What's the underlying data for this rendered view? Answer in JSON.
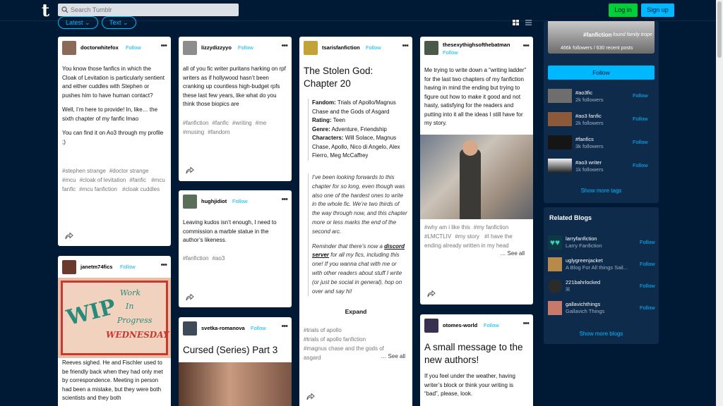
{
  "topbar": {
    "logo": "t",
    "search_placeholder": "Search Tumblr",
    "login": "Log in",
    "signup": "Sign up"
  },
  "filters": {
    "latest": "Latest ⌄",
    "text": "Text ⌄"
  },
  "posts": {
    "p1": {
      "user": "doctorwhitefox",
      "follow": "Follow",
      "paras": [
        "You know those fanfics in which the Cloak of Levitation is particularly sentient and either cuddles with Stephen or pushes him to have human contact?",
        "Well, I’m here to provide! In, like… the sixth chapter of my fanfic lmao",
        "You can find it on Ao3 through my profile ;)"
      ],
      "tags": [
        "#stephen strange",
        "#doctor strange",
        "#mcu",
        "#cloak of levitation",
        "#fanfic",
        "#mcu fanfic",
        "#mcu fanfiction",
        "#cloak cuddles"
      ]
    },
    "p2": {
      "user": "janetm74fics",
      "follow": "Follow",
      "img_lines": [
        "WIP",
        "Work",
        "In",
        "Progress",
        "WEDNESDAY"
      ],
      "text": "Reeves sighed. He and Fischler used to be friendly back when they had only met by correspondence. Meeting in person had been a mistake, but they were both scientists and they both"
    },
    "p3": {
      "user": "lizzydizzyyo",
      "follow": "Follow",
      "text": "all of you fic writer puritans harking on rpf writers as if hollywood hasn’t been cranking up countless high-budget rpfs these last few years, like what do you think those biopics are",
      "tags": [
        "#fanfiction",
        "#fanfic",
        "#writing",
        "#me",
        "#musing",
        "#fandom"
      ]
    },
    "p4": {
      "user": "hughjidiot",
      "follow": "Follow",
      "text": "Leaving kudos isn’t enough, I need to commission a marble statue in the author’s likeness.",
      "tags": [
        "#fanfiction",
        "#ao3"
      ]
    },
    "p5": {
      "user": "svetka-romanova",
      "follow": "Follow",
      "title": "Cursed (Series) Part 3"
    },
    "p6": {
      "user": "tsarisfanfiction",
      "follow": "Follow",
      "title": "The Stolen God: Chapter 20",
      "fandom_label": "Fandom:",
      "fandom": "Trials of Apollo/Magnus Chase and the Gods of Asgard",
      "rating_label": "Rating:",
      "rating": "Teen",
      "genre_label": "Genre:",
      "genre": "Adventure, Friendship",
      "chars_label": "Characters:",
      "chars": "Will Solace, Magnus Chase, Apollo, Nico di Angelo, Alex Fierro, Meg McCaffrey",
      "ital1": "I’ve been looking forwards to this chapter for so long, even though was also one of the hardest ones to write in the whole fic.  We’re two thirds of the way through now, and this chapter more or less marks the end of the second arc.",
      "ital2a": "Reminder that there’s now a ",
      "ital2link": "discord server",
      "ital2b": " for all my fics, including this one!  If you wanna chat with me or with other readers about stuff I write (or just be social in general), hop on over and say hi!",
      "expand": "Expand",
      "tags": [
        "#trials of apollo",
        "#trials of apollo fanfiction",
        "#magnus chase and the gods of asgard"
      ],
      "see_all": "… See all"
    },
    "p7": {
      "user": "thesexythighsofthebatman",
      "follow": "Follow",
      "text": "Me trying to write down a “writing ladder” for the last two chapters of my fanfiction having in mind the ending but trying to figure out how to make it good and not hasty, satisfying for the readers and putting into it all the ideas I still have for my story.",
      "tags": [
        "#why am i like this",
        "#my fanfiction",
        "#LMCTLIV",
        "#my story",
        "#I have the ending already written in my head"
      ],
      "see_all": "… See all"
    },
    "p8": {
      "user": "otomes-world",
      "follow": "Follow",
      "title": "A small message to the new authors!",
      "text": "If you feel under the weather, having writer’s block or think your writing is “bad”, please, look."
    }
  },
  "sidebar": {
    "hero_tag": "#fanfiction",
    "hero_sub": "found family trope",
    "hero_stats": "466k followers / 630 recent posts",
    "follow_btn": "Follow",
    "tags": [
      {
        "name": "#ao3fic",
        "count": "2k followers",
        "follow": "Follow"
      },
      {
        "name": "#ao3 fanfic",
        "count": "2k followers",
        "follow": "Follow"
      },
      {
        "name": "#fanfics",
        "count": "3k followers",
        "follow": "Follow"
      },
      {
        "name": "#ao3 writer",
        "count": "1k followers",
        "follow": "Follow"
      }
    ],
    "show_more_tags": "Show more tags",
    "related_title": "Related Blogs",
    "blogs": [
      {
        "name": "larryfanfiction",
        "desc": "Larry Fanfiction",
        "follow": "Follow"
      },
      {
        "name": "uglygreenjacket",
        "desc": "A Blog For All things Sail...",
        "follow": "Follow"
      },
      {
        "name": "221bahrlocked",
        "desc": "ꕤ",
        "follow": "Follow"
      },
      {
        "name": "gallavichthings",
        "desc": "Gallavich Things",
        "follow": "Follow"
      }
    ],
    "show_more_blogs": "Show more blogs"
  },
  "colors": {
    "bg": "#001935",
    "accent": "#00b8ff",
    "login": "#00cf35",
    "panel": "#0e2b4b"
  }
}
